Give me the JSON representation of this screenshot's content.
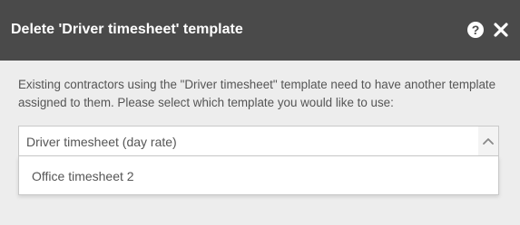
{
  "dialog": {
    "title": "Delete 'Driver timesheet' template",
    "help_icon": "question-circle-icon",
    "help_symbol": "?",
    "close_icon": "close-icon",
    "header_color": "#4a4a4a"
  },
  "message": "Existing contractors using the \"Driver timesheet\" template need to have another template assigned to them. Please select which template you would like to use:",
  "select": {
    "selected_value": "Driver timesheet (day rate)",
    "arrow_icon": "chevron-up-icon",
    "options": [
      {
        "label": "Office timesheet 2"
      }
    ]
  }
}
